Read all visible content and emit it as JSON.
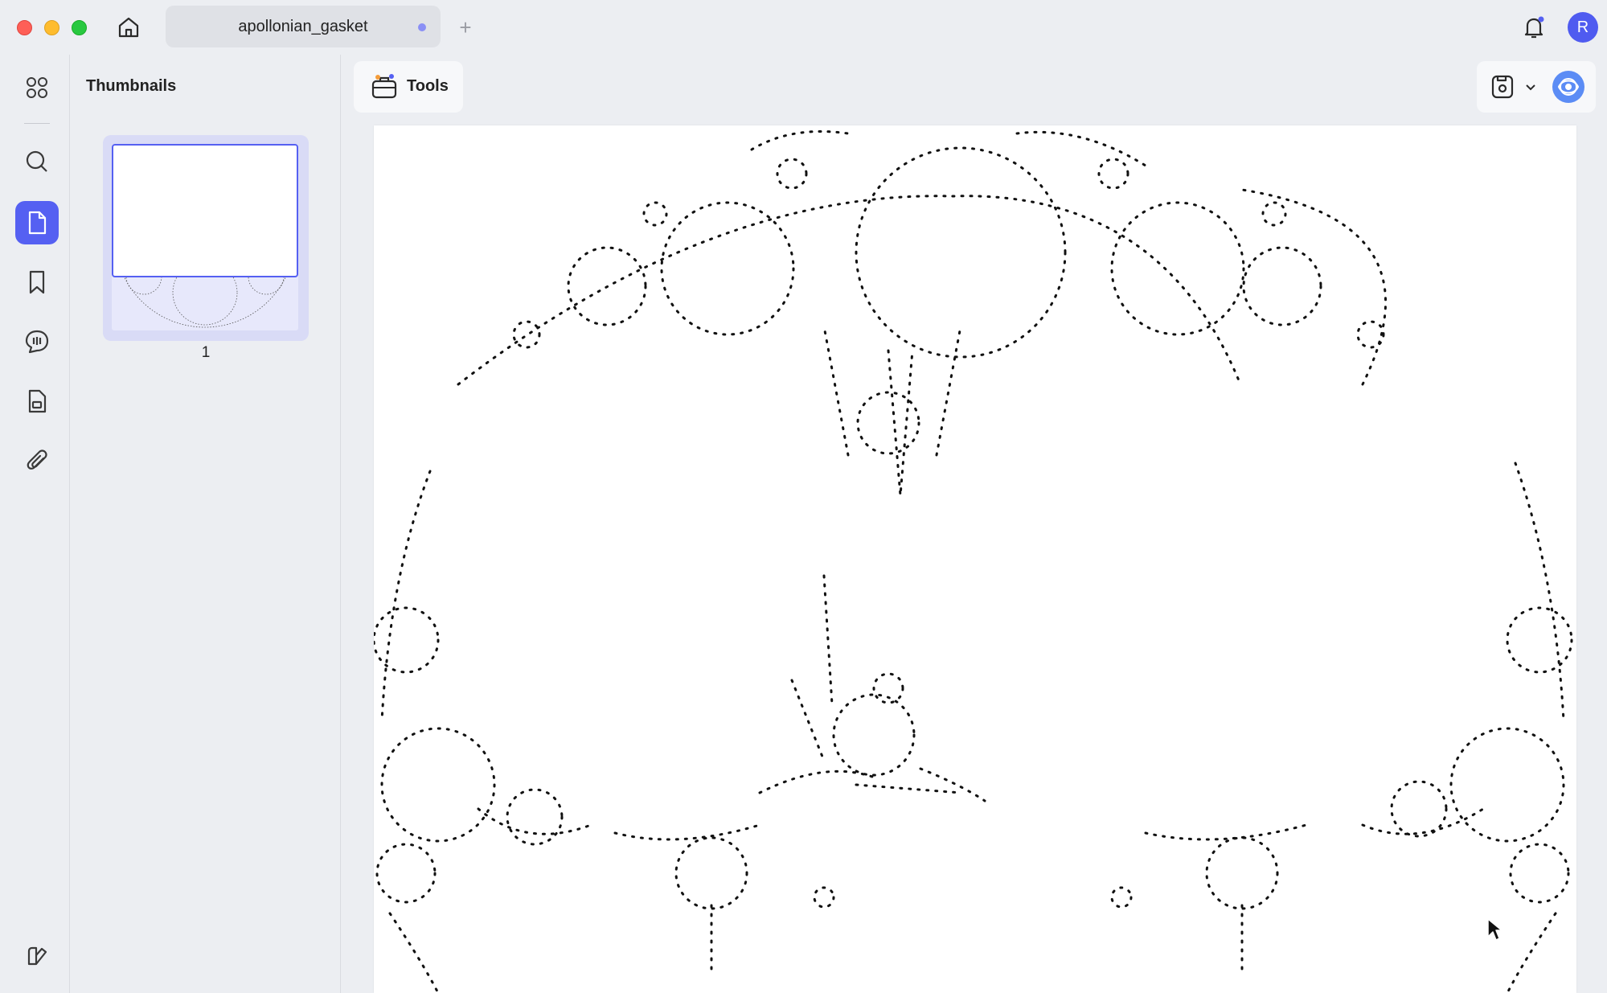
{
  "window": {
    "tab_title": "apollonian_gasket",
    "new_tab_symbol": "+",
    "user_initial": "R"
  },
  "icons": {
    "home": "home-icon",
    "bell": "bell-icon",
    "apps": "grid-icon",
    "search": "search-icon",
    "page": "page-icon",
    "bookmark": "bookmark-icon",
    "comment": "comment-icon",
    "form": "form-icon",
    "attachment": "paperclip-icon",
    "sidebar_toggle": "sidebar-toggle-icon",
    "tools": "toolbox-icon",
    "save": "save-icon",
    "ai": "ai-assistant-icon"
  },
  "sidebar": {
    "title": "Thumbnails",
    "pages": [
      {
        "number": "1"
      }
    ]
  },
  "toolbar": {
    "tools_label": "Tools"
  },
  "colors": {
    "accent": "#5560f2",
    "background": "#eceef2",
    "page": "#ffffff",
    "ink": "#111111"
  }
}
